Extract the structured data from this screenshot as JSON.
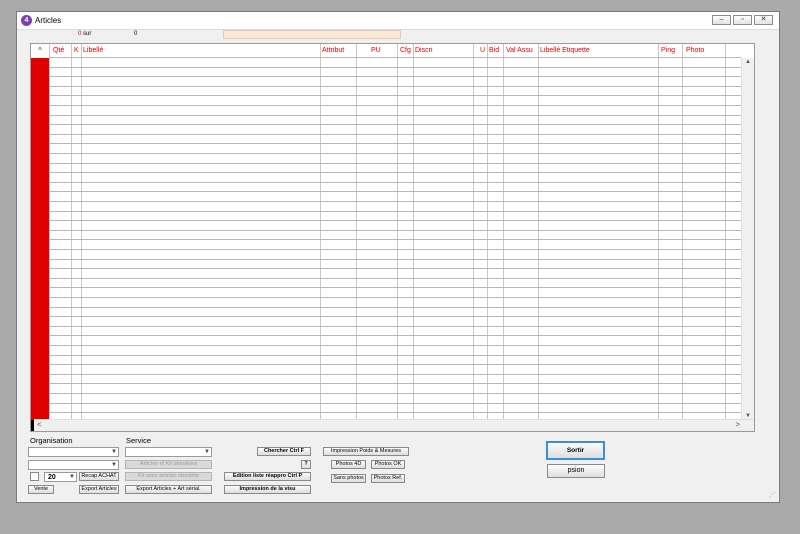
{
  "window": {
    "title": "Articles",
    "icon": "4d-app-icon"
  },
  "counter": {
    "found": "0",
    "separator": "sur",
    "total": "0"
  },
  "grid": {
    "sort_glyph": "^",
    "columns": [
      "Qté",
      "K",
      "Libellé",
      "Attribut",
      "PU",
      "Cfg",
      "Discri",
      "U",
      "Bid",
      "Val Assu",
      "Libellé Etiquette",
      "Ping",
      "Photo"
    ],
    "scroll_up": "▲",
    "scroll_down": "▼",
    "scroll_left": "<",
    "scroll_right": ">"
  },
  "organisation": {
    "label": "Organisation",
    "page_size_value": "20",
    "recap_achat": "Recap ACHAT",
    "vente": "Vente",
    "export_articles": "Export Articles"
  },
  "service": {
    "label": "Service",
    "articles_kit_obsoletes": "Articles et Kit obsolètes",
    "kit_articles_obsolete": "Kit avec articles obsolète",
    "export_articles_serial": "Export Articles + Art sérial."
  },
  "actions": {
    "chercher": "Chercher Ctrl F",
    "help": "?",
    "edition_liste": "Edition liste réappro Ctrl P",
    "impression_visu": "Impression de la visu",
    "impression_poids": "Impression Poids & Mesures",
    "photos_4d": "Photos 4D",
    "photos_ok": "Photos OK",
    "sans_photos": "Sans photos",
    "photos_ref": "Photos Ref.",
    "sortir": "Sortir",
    "psion": "psion"
  },
  "colors": {
    "header_red": "#e00000",
    "progress_field": "#fbe9d5",
    "default_button_border": "#3b8fd9"
  }
}
